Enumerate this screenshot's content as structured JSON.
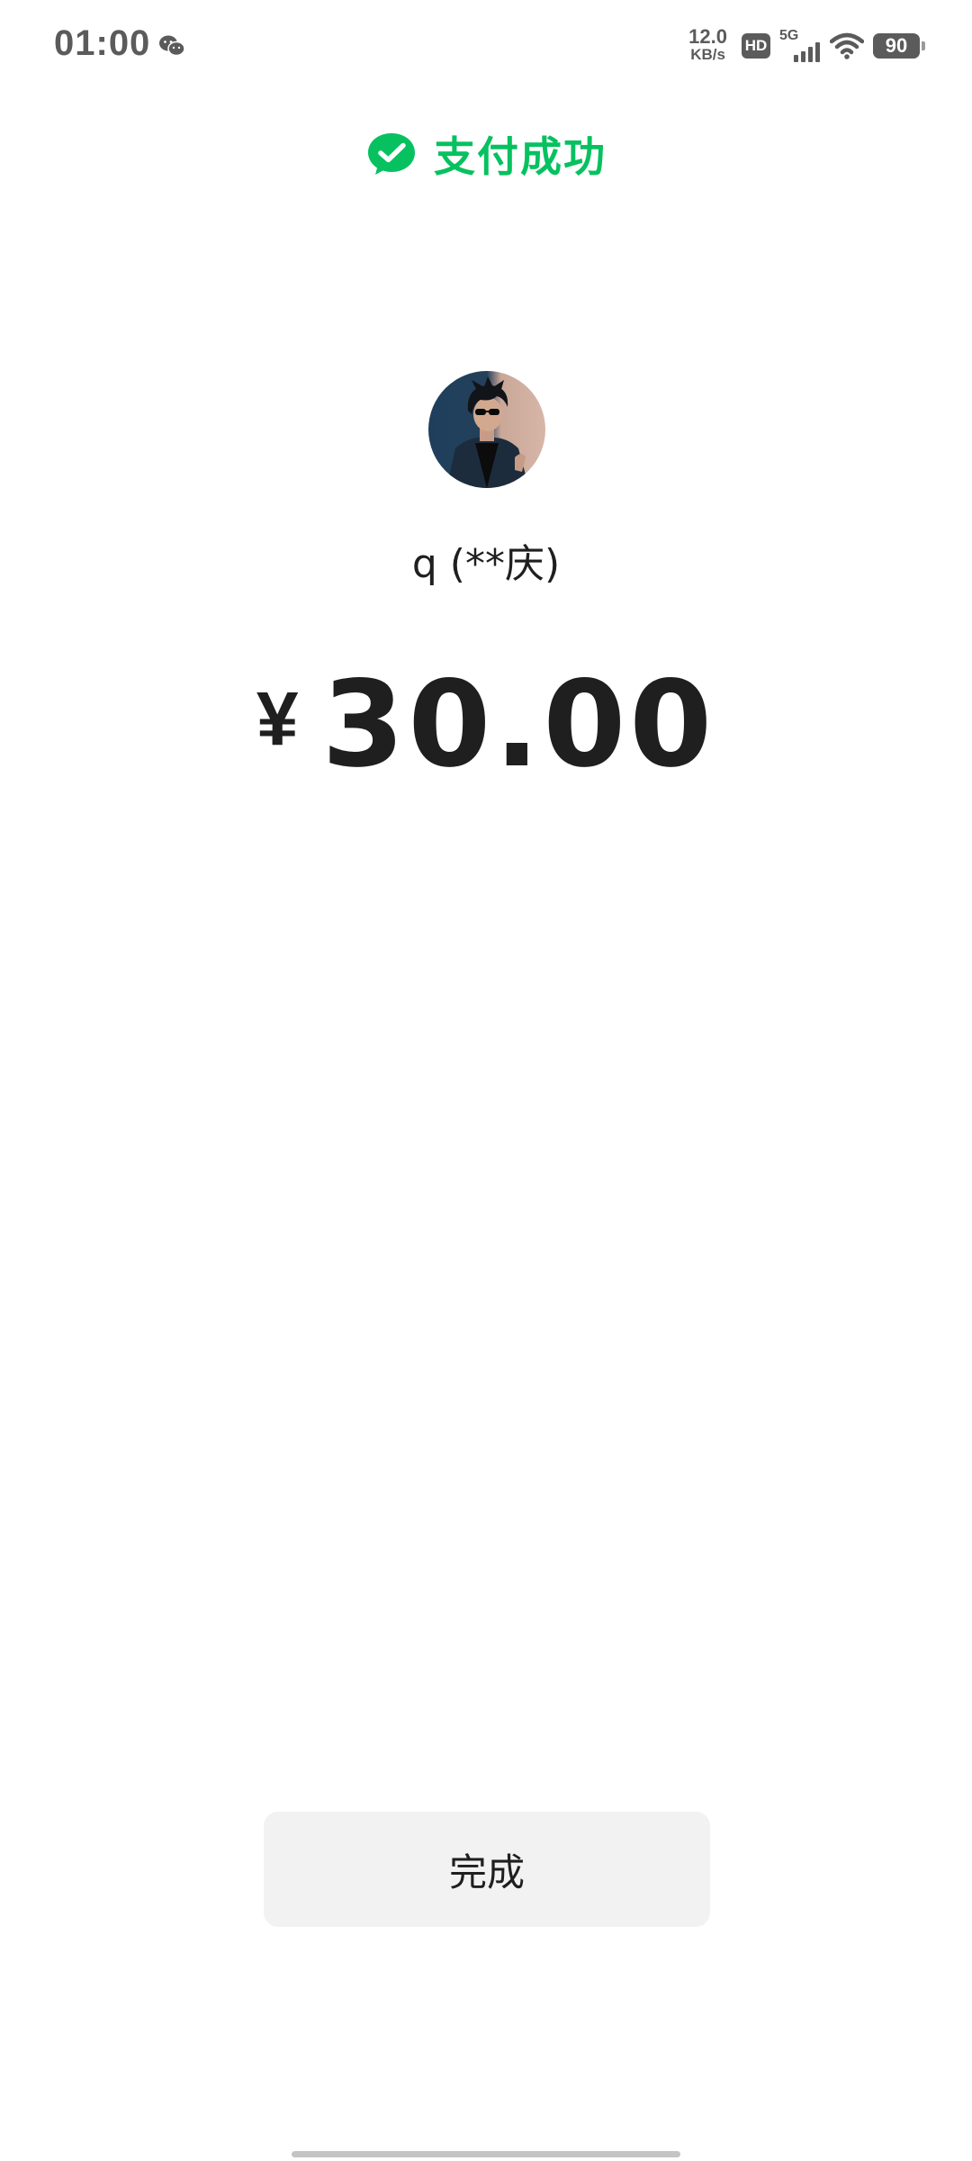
{
  "status_bar": {
    "time": "01:00",
    "notification_icon": "wechat-icon",
    "net_speed_value": "12.0",
    "net_speed_unit": "KB/s",
    "hd_label": "HD",
    "network_type": "5G",
    "wifi_icon": "wifi-icon",
    "battery_level": "90"
  },
  "header": {
    "icon": "wechat-pay-success-icon",
    "title": "支付成功",
    "accent_color": "#07c160"
  },
  "payee": {
    "avatar": "user-avatar",
    "name": "q (**庆)"
  },
  "amount": {
    "currency_symbol": "¥",
    "value": "30.00"
  },
  "actions": {
    "done_label": "完成"
  }
}
